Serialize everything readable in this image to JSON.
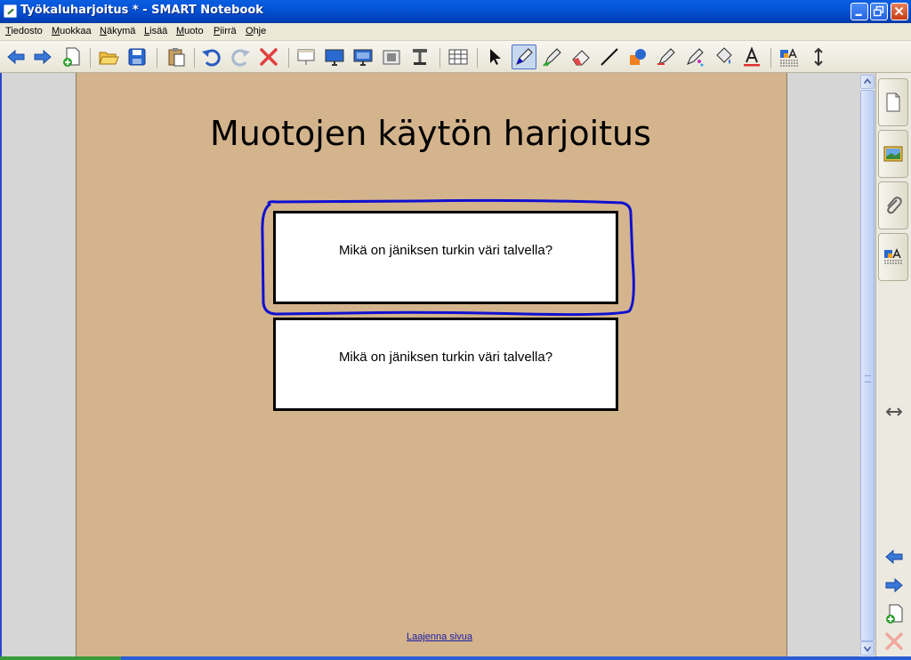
{
  "window": {
    "title": "Työkaluharjoitus * - SMART Notebook",
    "minimize_label": "_",
    "restore_label": "❐",
    "close_label": "✕"
  },
  "menu": {
    "items": [
      "Tiedosto",
      "Muokkaa",
      "Näkymä",
      "Lisää",
      "Muoto",
      "Piirrä",
      "Ohje"
    ]
  },
  "toolbar": {
    "buttons": [
      "back-icon",
      "forward-icon",
      "add-page-icon",
      "open-folder-icon",
      "save-icon",
      "paste-icon",
      "undo-icon",
      "redo-icon",
      "delete-icon",
      "screen-shade-icon",
      "full-screen-icon",
      "dual-display-icon",
      "capture-icon",
      "document-camera-icon",
      "table-icon",
      "select-icon",
      "pen-icon",
      "creative-pen-icon",
      "eraser-icon",
      "line-icon",
      "shapes-icon",
      "magic-pen-icon",
      "highlighter-icon",
      "fill-icon",
      "text-icon",
      "properties-icon",
      "move-toolbar-icon"
    ],
    "active": "pen-icon"
  },
  "page": {
    "title": "Muotojen käytön harjoitus",
    "question_1": "Mikä on jäniksen turkin väri talvella?",
    "question_2": "Mikä on jäniksen turkin väri talvella?",
    "expand_link": "Laajenna sivua",
    "background_color": "#d4b48c",
    "pen_color": "#1010d0"
  },
  "sidebar": {
    "tabs": [
      "page-sorter-icon",
      "gallery-icon",
      "attachments-icon",
      "properties-icon"
    ],
    "buttons": [
      "move-sidebar-icon",
      "previous-page-icon",
      "next-page-icon",
      "add-page-icon",
      "delete-page-icon"
    ]
  }
}
